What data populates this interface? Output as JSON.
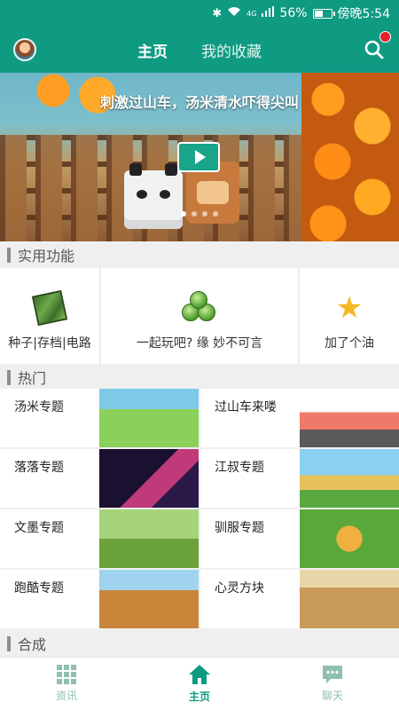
{
  "status_bar": {
    "signal_label": "4G",
    "battery": "56%",
    "battery_level": 0.56,
    "time": "傍晚5:54"
  },
  "header": {
    "tabs": [
      {
        "label": "主页",
        "active": true
      },
      {
        "label": "我的收藏",
        "active": false
      }
    ],
    "search_icon": "search-icon",
    "notification_color": "#e5202a"
  },
  "banner": {
    "title": "刺激过山车，汤米清水吓得尖叫",
    "play_icon": "play-icon",
    "page_count": 4,
    "current_page": 1
  },
  "features": {
    "header": "实用功能",
    "items": [
      {
        "label": "种子|存档|电路",
        "icon": "map-icon"
      },
      {
        "label": "一起玩吧? 缘 妙不可言",
        "icon": "green-balls-icon"
      },
      {
        "label": "加了个油",
        "icon": "star-icon"
      }
    ]
  },
  "hot": {
    "header": "热门",
    "items": [
      {
        "name": "汤米专题"
      },
      {
        "name": "过山车来喽"
      },
      {
        "name": "落落专题"
      },
      {
        "name": "江叔专题"
      },
      {
        "name": "文墨专题"
      },
      {
        "name": "驯服专题"
      },
      {
        "name": "跑酷专题"
      },
      {
        "name": "心灵方块"
      }
    ]
  },
  "compose": {
    "header": "合成"
  },
  "bottom_nav": [
    {
      "label": "资讯",
      "icon": "grid-icon",
      "active": false
    },
    {
      "label": "主页",
      "icon": "home-icon",
      "active": true
    },
    {
      "label": "聊天",
      "icon": "chat-icon",
      "active": false
    }
  ],
  "colors": {
    "brand": "#0f9a82",
    "nav_inactive": "#8fbfb3"
  }
}
